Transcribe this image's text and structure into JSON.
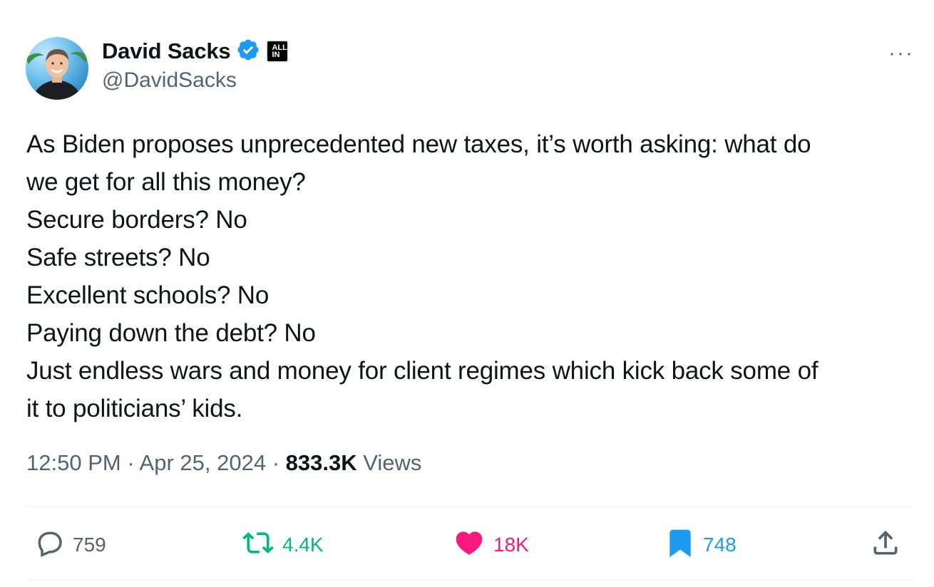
{
  "user": {
    "display_name": "David Sacks",
    "handle": "@DavidSacks",
    "affiliation_badge": [
      "ALL",
      "IN"
    ]
  },
  "more_label": "···",
  "tweet": {
    "lines": [
      "As Biden proposes unprecedented new taxes, it’s worth asking: what do",
      "we get for all this money?",
      "Secure borders? No",
      "Safe streets? No",
      "Excellent schools? No",
      "Paying down the debt? No",
      "Just endless wars and money for client regimes which kick back some of",
      "it to politicians’ kids."
    ]
  },
  "meta": {
    "time": "12:50 PM",
    "sep1": " · ",
    "date": "Apr 25, 2024",
    "sep2": " · ",
    "views_count": "833.3K",
    "views_label": " Views"
  },
  "actions": {
    "replies": "759",
    "reposts": "4.4K",
    "likes": "18K",
    "bookmarks": "748"
  },
  "colors": {
    "text_primary": "#0f1419",
    "text_secondary": "#536471",
    "verified_blue": "#1d9bf0",
    "repost_green": "#00ba7c",
    "like_pink": "#f91880",
    "bookmark_blue": "#1d9bf0"
  },
  "icons": {
    "reply": "speech-bubble-icon",
    "repost": "repost-arrows-icon",
    "like": "heart-icon",
    "bookmark": "bookmark-icon",
    "share": "share-upload-icon",
    "verified": "verified-check-icon"
  }
}
